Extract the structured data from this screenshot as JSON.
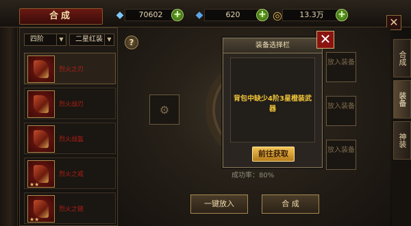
{
  "header": {
    "title": "合成",
    "resources": [
      {
        "icon": "blue-diamond-icon",
        "value": "70602"
      },
      {
        "icon": "blue-crystal-icon",
        "value": "620"
      },
      {
        "icon": "gold-coin-icon",
        "value": "13.3万"
      }
    ]
  },
  "filters": {
    "tier": "四阶",
    "quality": "二星红装"
  },
  "items": [
    {
      "name": "烈火之刃"
    },
    {
      "name": "烈火战刃"
    },
    {
      "name": "烈火战盔"
    },
    {
      "name": "烈火之戒"
    },
    {
      "name": "烈火之链"
    }
  ],
  "slots": {
    "put_label": "放入装备"
  },
  "success_rate": "成功率：80%",
  "buttons": {
    "auto_put": "一键放入",
    "compose": "合 成"
  },
  "right_tabs": [
    "合成",
    "装备",
    "神装"
  ],
  "modal": {
    "title": "装备选择栏",
    "message": "背包中缺少4阶3星橙装武器",
    "go_button": "前往获取"
  },
  "colors": {
    "accent": "#f1c63a",
    "danger": "#8a1411",
    "item_text": "#b31f15"
  }
}
